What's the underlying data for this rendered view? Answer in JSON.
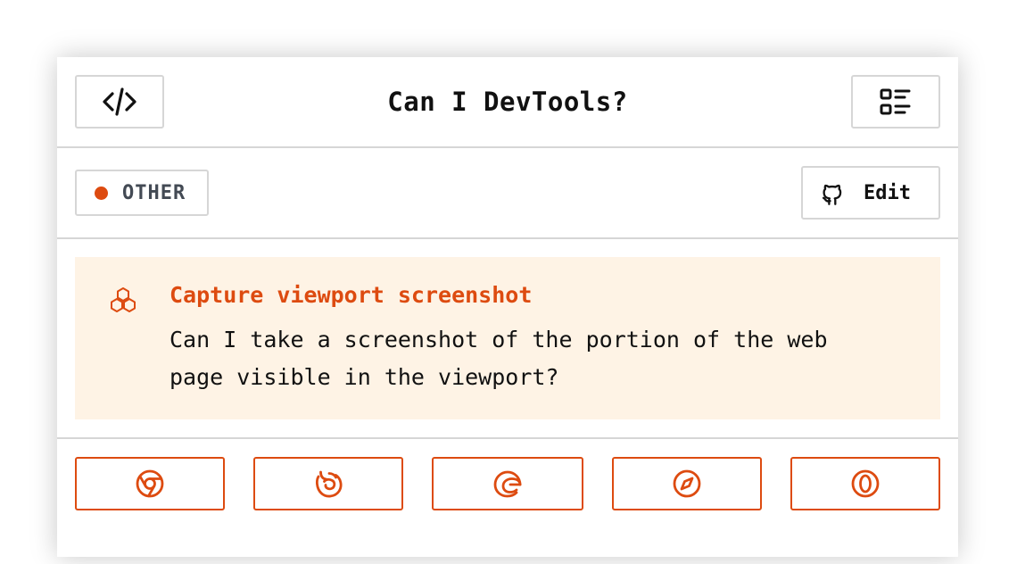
{
  "header": {
    "title": "Can I DevTools?",
    "code_button_icon": "code-icon",
    "menu_button_icon": "list-icon"
  },
  "meta": {
    "category": "OTHER",
    "category_color": "#dd4b10",
    "edit_label": "Edit",
    "edit_icon": "github-icon"
  },
  "feature": {
    "icon": "hexagons-icon",
    "title": "Capture viewport screenshot",
    "description": "Can I take a screenshot of the portion of the web page visible in the viewport?",
    "background_color": "#fef3e5",
    "accent_color": "#dd4b10"
  },
  "browsers": [
    {
      "icon": "chrome-icon"
    },
    {
      "icon": "firefox-icon"
    },
    {
      "icon": "edge-icon"
    },
    {
      "icon": "safari-icon"
    },
    {
      "icon": "opera-icon"
    }
  ]
}
